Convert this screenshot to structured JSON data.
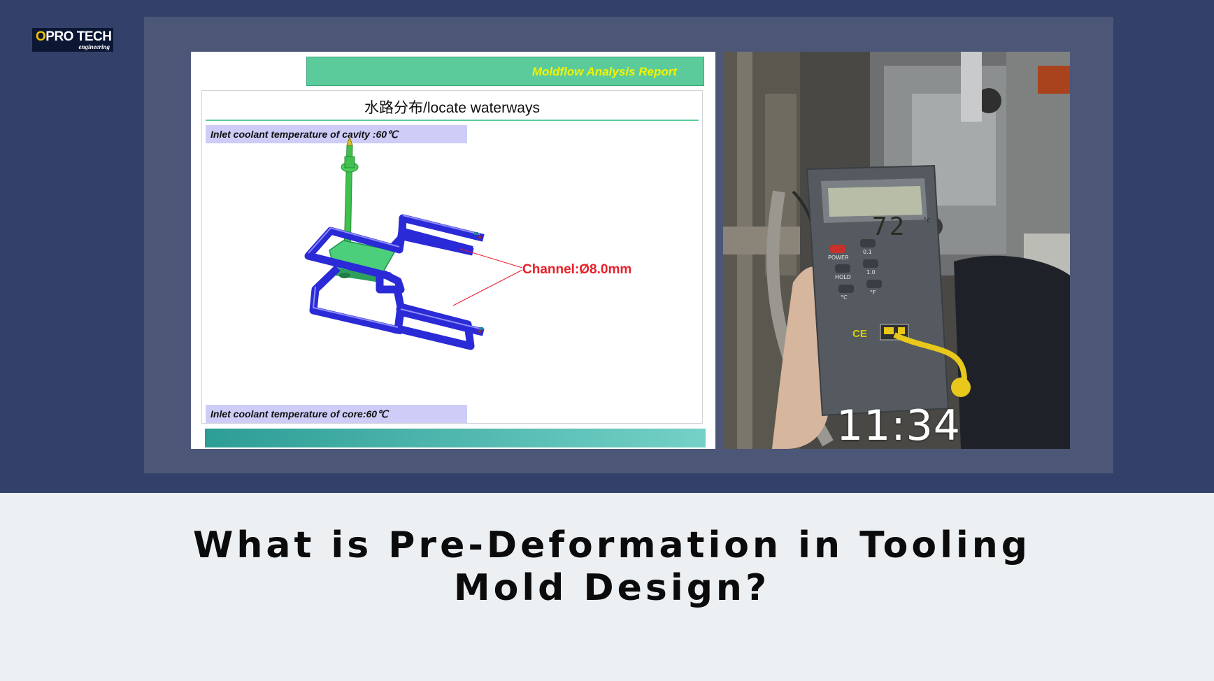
{
  "logo": {
    "brand_o": "O",
    "brand_rest": "PRO TECH",
    "sub": "engineering"
  },
  "report_slide": {
    "header": "Moldflow Analysis Report",
    "section_title": "水路分布/locate waterways",
    "cavity_label": "Inlet coolant temperature of  cavity :60℃",
    "core_label": "Inlet coolant temperature of core:60℃",
    "callout": "Channel:Ø8.0mm",
    "colors": {
      "header_bg": "#5ccb9c",
      "header_text": "#f3f300",
      "label_bg": "#cdcdf8",
      "channel": "#2a2ad6",
      "part": "#33c66a",
      "callout": "#e8202a"
    }
  },
  "photo": {
    "meter_reading": "72",
    "meter_unit": "°c",
    "buttons": [
      "POWER",
      "0.1",
      "HOLD",
      "1.0",
      "°C",
      "°F"
    ],
    "ce_mark": "CE",
    "timestamp": "11:34"
  },
  "article": {
    "title": "What is Pre-Deformation in Tooling Mold Design?"
  }
}
